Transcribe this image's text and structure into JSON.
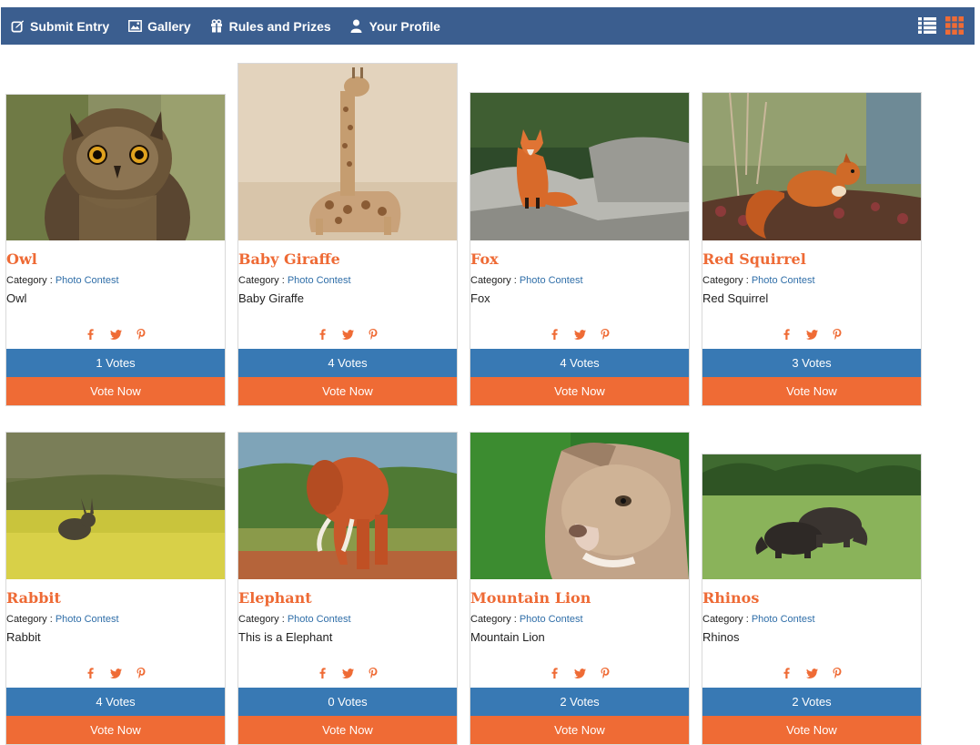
{
  "nav": {
    "items": [
      {
        "label": "Submit Entry",
        "icon": "edit-icon"
      },
      {
        "label": "Gallery",
        "icon": "image-icon"
      },
      {
        "label": "Rules and Prizes",
        "icon": "gift-icon"
      },
      {
        "label": "Your Profile",
        "icon": "user-icon"
      }
    ],
    "views": [
      {
        "icon": "list-view-icon",
        "color": "#ffffff"
      },
      {
        "icon": "grid-view-icon",
        "color": "#ef6b35"
      }
    ]
  },
  "labels": {
    "category_prefix": "Category : ",
    "vote_button": "Vote Now"
  },
  "colors": {
    "nav_bg": "#3b5e8f",
    "accent": "#ef6b35",
    "votes_bg": "#3879b4",
    "link": "#2f6ea8"
  },
  "entries": [
    {
      "title": "Owl",
      "category": "Photo Contest",
      "description": "Owl",
      "votes": "1 Votes"
    },
    {
      "title": "Baby Giraffe",
      "category": "Photo Contest",
      "description": "Baby Giraffe",
      "votes": "4 Votes"
    },
    {
      "title": "Fox",
      "category": "Photo Contest",
      "description": "Fox",
      "votes": "4 Votes"
    },
    {
      "title": "Red Squirrel",
      "category": "Photo Contest",
      "description": "Red Squirrel",
      "votes": "3 Votes"
    },
    {
      "title": "Rabbit",
      "category": "Photo Contest",
      "description": "Rabbit",
      "votes": "4 Votes"
    },
    {
      "title": "Elephant",
      "category": "Photo Contest",
      "description": "This is a Elephant",
      "votes": "0 Votes"
    },
    {
      "title": "Mountain Lion",
      "category": "Photo Contest",
      "description": "Mountain Lion",
      "votes": "2 Votes"
    },
    {
      "title": "Rhinos",
      "category": "Photo Contest",
      "description": "Rhinos",
      "votes": "2 Votes"
    }
  ]
}
